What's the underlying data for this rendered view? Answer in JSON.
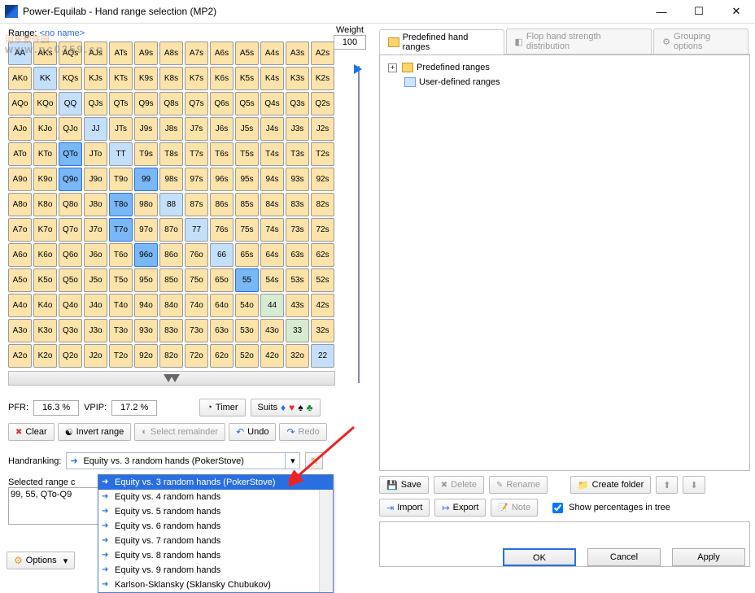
{
  "window": {
    "title": "Power-Equilab - Hand range selection (MP2)"
  },
  "watermark": {
    "main": "河东软件园",
    "sub": "www.pc0359.cn"
  },
  "left": {
    "range_label": "Range:",
    "range_name": "<no name>",
    "weight_label": "Weight",
    "weight_value": "100",
    "pfr_label": "PFR:",
    "pfr_value": "16.3 %",
    "vpip_label": "VPIP:",
    "vpip_value": "17.2 %",
    "timer": "Timer",
    "suits": "Suits",
    "clear": "Clear",
    "invert": "Invert range",
    "select_remainder": "Select remainder",
    "undo": "Undo",
    "redo": "Redo",
    "handranking_label": "Handranking:",
    "handranking_value": "Equity vs. 3 random hands (PokerStove)",
    "selected_col_label": "Selected range c",
    "range_text": "99, 55, QTo-Q9",
    "options": "Options"
  },
  "dropdown": [
    {
      "t": "Equity vs. 3 random hands (PokerStove)",
      "sel": true
    },
    {
      "t": "Equity vs. 4 random hands"
    },
    {
      "t": "Equity vs. 5 random hands"
    },
    {
      "t": "Equity vs. 6 random hands"
    },
    {
      "t": "Equity vs. 7 random hands"
    },
    {
      "t": "Equity vs. 8 random hands"
    },
    {
      "t": "Equity vs. 9 random hands"
    },
    {
      "t": "Karlson-Sklansky (Sklansky Chubukov)"
    }
  ],
  "grid_labels": [
    "AA",
    "AKs",
    "AQs",
    "AJs",
    "ATs",
    "A9s",
    "A8s",
    "A7s",
    "A6s",
    "A5s",
    "A4s",
    "A3s",
    "A2s",
    "AKo",
    "KK",
    "KQs",
    "KJs",
    "KTs",
    "K9s",
    "K8s",
    "K7s",
    "K6s",
    "K5s",
    "K4s",
    "K3s",
    "K2s",
    "AQo",
    "KQo",
    "QQ",
    "QJs",
    "QTs",
    "Q9s",
    "Q8s",
    "Q7s",
    "Q6s",
    "Q5s",
    "Q4s",
    "Q3s",
    "Q2s",
    "AJo",
    "KJo",
    "QJo",
    "JJ",
    "JTs",
    "J9s",
    "J8s",
    "J7s",
    "J6s",
    "J5s",
    "J4s",
    "J3s",
    "J2s",
    "ATo",
    "KTo",
    "QTo",
    "JTo",
    "TT",
    "T9s",
    "T8s",
    "T7s",
    "T6s",
    "T5s",
    "T4s",
    "T3s",
    "T2s",
    "A9o",
    "K9o",
    "Q9o",
    "J9o",
    "T9o",
    "99",
    "98s",
    "97s",
    "96s",
    "95s",
    "94s",
    "93s",
    "92s",
    "A8o",
    "K8o",
    "Q8o",
    "J8o",
    "T8o",
    "98o",
    "88",
    "87s",
    "86s",
    "85s",
    "84s",
    "83s",
    "82s",
    "A7o",
    "K7o",
    "Q7o",
    "J7o",
    "T7o",
    "97o",
    "87o",
    "77",
    "76s",
    "75s",
    "74s",
    "73s",
    "72s",
    "A6o",
    "K6o",
    "Q6o",
    "J6o",
    "T6o",
    "96o",
    "86o",
    "76o",
    "66",
    "65s",
    "64s",
    "63s",
    "62s",
    "A5o",
    "K5o",
    "Q5o",
    "J5o",
    "T5o",
    "95o",
    "85o",
    "75o",
    "65o",
    "55",
    "54s",
    "53s",
    "52s",
    "A4o",
    "K4o",
    "Q4o",
    "J4o",
    "T4o",
    "94o",
    "84o",
    "74o",
    "64o",
    "54o",
    "44",
    "43s",
    "42s",
    "A3o",
    "K3o",
    "Q3o",
    "J3o",
    "T3o",
    "93o",
    "83o",
    "73o",
    "63o",
    "53o",
    "43o",
    "33",
    "32s",
    "A2o",
    "K2o",
    "Q2o",
    "J2o",
    "T2o",
    "92o",
    "82o",
    "72o",
    "62o",
    "52o",
    "42o",
    "32o",
    "22"
  ],
  "grid_style": [
    "s",
    "y",
    "y",
    "y",
    "y",
    "y",
    "y",
    "y",
    "y",
    "y",
    "y",
    "y",
    "y",
    "y",
    "s",
    "y",
    "y",
    "y",
    "y",
    "y",
    "y",
    "y",
    "y",
    "y",
    "y",
    "y",
    "y",
    "y",
    "s",
    "y",
    "y",
    "y",
    "y",
    "y",
    "y",
    "y",
    "y",
    "y",
    "y",
    "y",
    "y",
    "y",
    "s",
    "y",
    "y",
    "y",
    "y",
    "y",
    "y",
    "y",
    "y",
    "y",
    "y",
    "y",
    "b",
    "y",
    "s",
    "y",
    "y",
    "y",
    "y",
    "y",
    "y",
    "y",
    "y",
    "y",
    "y",
    "b",
    "y",
    "y",
    "b",
    "y",
    "y",
    "y",
    "y",
    "y",
    "y",
    "y",
    "y",
    "y",
    "y",
    "y",
    "b",
    "y",
    "s",
    "y",
    "y",
    "y",
    "y",
    "y",
    "y",
    "y",
    "y",
    "y",
    "y",
    "b",
    "y",
    "y",
    "s",
    "y",
    "y",
    "y",
    "y",
    "y",
    "y",
    "y",
    "y",
    "y",
    "y",
    "b",
    "y",
    "y",
    "s",
    "y",
    "y",
    "y",
    "y",
    "y",
    "y",
    "y",
    "y",
    "y",
    "y",
    "y",
    "y",
    "y",
    "b",
    "y",
    "y",
    "y",
    "y",
    "y",
    "y",
    "y",
    "y",
    "y",
    "y",
    "y",
    "y",
    "y",
    "g",
    "y",
    "y",
    "y",
    "y",
    "y",
    "y",
    "y",
    "y",
    "y",
    "y",
    "y",
    "y",
    "y",
    "g",
    "y",
    "y",
    "y",
    "y",
    "y",
    "y",
    "y",
    "y",
    "y",
    "y",
    "y",
    "y",
    "y",
    "s"
  ],
  "right": {
    "tab1": "Predefined hand ranges",
    "tab2": "Flop hand strength distribution",
    "tab3": "Grouping options",
    "tree_root": "Predefined ranges",
    "tree_user": "User-defined ranges",
    "save": "Save",
    "delete": "Delete",
    "rename": "Rename",
    "create_folder": "Create folder",
    "import": "Import",
    "export": "Export",
    "note": "Note",
    "show_pct": "Show percentages in tree"
  },
  "dlg": {
    "ok": "OK",
    "cancel": "Cancel",
    "apply": "Apply"
  }
}
